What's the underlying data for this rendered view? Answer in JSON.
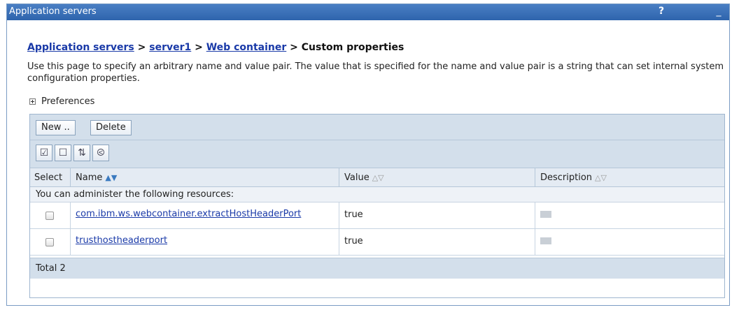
{
  "window": {
    "title": "Application servers",
    "help_label": "?",
    "minimize_label": "_"
  },
  "breadcrumb": {
    "items": [
      "Application servers",
      "server1",
      "Web container"
    ],
    "separator": ">",
    "current": "Custom properties"
  },
  "description": "Use this page to specify an arbitrary name and value pair. The value that is specified for the name and value pair is a string that can set internal system configuration properties.",
  "preferences": {
    "label": "Preferences"
  },
  "toolbar": {
    "new_label": "New ..",
    "delete_label": "Delete"
  },
  "icon_toolbar": [
    "select-all-icon",
    "deselect-all-icon",
    "show-filter-icon",
    "clear-filter-icon"
  ],
  "table": {
    "headers": {
      "select": "Select",
      "name": "Name",
      "value": "Value",
      "description": "Description"
    },
    "group_label": "You can administer the following resources:",
    "rows": [
      {
        "name": "com.ibm.ws.webcontainer.extractHostHeaderPort",
        "value": "true"
      },
      {
        "name": "trusthostheaderport",
        "value": "true"
      }
    ],
    "total": "Total 2"
  },
  "colors": {
    "titlebar": "#2e64ad",
    "link": "#1a3aa8",
    "toolbar_bg": "#d3dfeb"
  }
}
